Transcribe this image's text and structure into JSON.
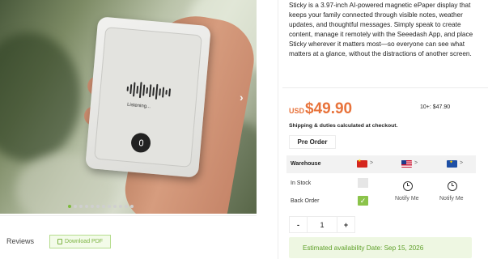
{
  "gallery": {
    "device_screen_text": "Listening...",
    "slide_count": 12,
    "active_slide": 1
  },
  "reviews": {
    "tab_label": "Reviews",
    "download_label": "Download PDF"
  },
  "product": {
    "description": "Sticky is a 3.97-inch AI-powered magnetic ePaper display that keeps your family connected through visible notes, weather updates, and thoughtful messages. Simply speak to create content, manage it remotely with the Seeedash App, and place Sticky wherever it matters most—so everyone can see what matters at a glance, without the distractions of another screen.",
    "currency": "USD",
    "price": "$49.90",
    "tier_price": "10+: $47.90",
    "shipping_note": "Shipping & duties calculated at checkout.",
    "preorder_label": "Pre Order",
    "accent_color": "#e8733b",
    "brand_green": "#7cb342"
  },
  "warehouse": {
    "label": "Warehouse",
    "regions": [
      {
        "flag": "china-flag-icon",
        "arrow": ">"
      },
      {
        "flag": "usa-flag-icon",
        "arrow": ">"
      },
      {
        "flag": "eu-flag-icon",
        "arrow": ">"
      }
    ],
    "rows": [
      {
        "label": "In Stock"
      },
      {
        "label": "Back Order"
      }
    ],
    "notify_label": "Notify Me"
  },
  "quantity": {
    "minus": "-",
    "value": "1",
    "plus": "+"
  },
  "availability": {
    "text": "Estimated availability Date: Sep 15, 2026"
  }
}
